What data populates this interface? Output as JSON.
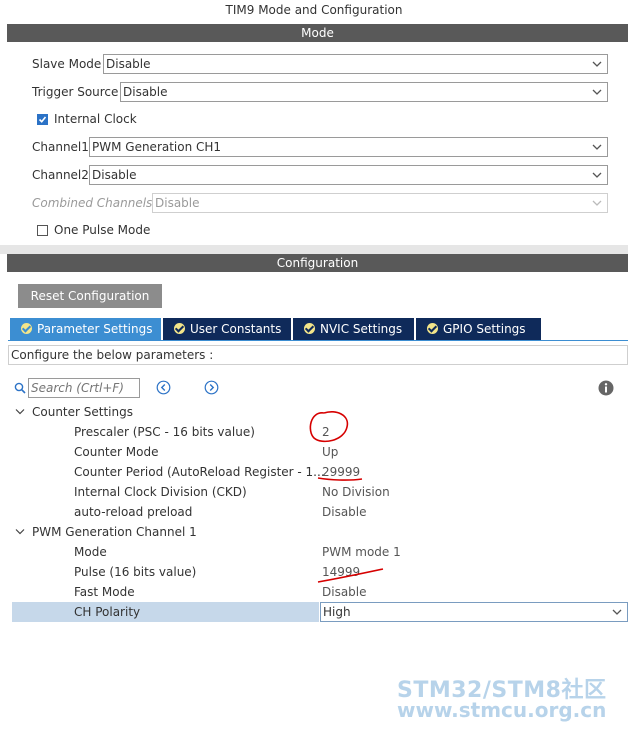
{
  "window": {
    "title": "TIM9 Mode and Configuration"
  },
  "mode": {
    "header": "Mode",
    "slave_mode": {
      "label": "Slave Mode",
      "value": "Disable"
    },
    "trigger_source": {
      "label": "Trigger Source",
      "value": "Disable"
    },
    "internal_clock": {
      "label": "Internal Clock",
      "checked": true
    },
    "channel1": {
      "label": "Channel1",
      "value": "PWM Generation CH1"
    },
    "channel2": {
      "label": "Channel2",
      "value": "Disable"
    },
    "combined_channels": {
      "label": "Combined Channels",
      "value": "Disable"
    },
    "one_pulse_mode": {
      "label": "One Pulse Mode",
      "checked": false
    }
  },
  "configuration": {
    "header": "Configuration",
    "reset_button": "Reset Configuration",
    "tabs": [
      {
        "label": "Parameter Settings",
        "active": true
      },
      {
        "label": "User Constants",
        "active": false
      },
      {
        "label": "NVIC Settings",
        "active": false
      },
      {
        "label": "GPIO Settings",
        "active": false
      }
    ],
    "instruction": "Configure the below parameters :",
    "search": {
      "placeholder": "Search (Crtl+F)"
    },
    "groups": {
      "counter": {
        "title": "Counter Settings",
        "rows": [
          {
            "label": "Prescaler (PSC - 16 bits value)",
            "value": "2"
          },
          {
            "label": "Counter Mode",
            "value": "Up"
          },
          {
            "label": "Counter Period (AutoReload Register - 1...",
            "value": "29999"
          },
          {
            "label": "Internal Clock Division (CKD)",
            "value": "No Division"
          },
          {
            "label": "auto-reload preload",
            "value": "Disable"
          }
        ]
      },
      "pwm": {
        "title": "PWM Generation Channel 1",
        "rows": [
          {
            "label": "Mode",
            "value": "PWM mode 1"
          },
          {
            "label": "Pulse (16 bits value)",
            "value": "14999"
          },
          {
            "label": "Fast Mode",
            "value": "Disable"
          },
          {
            "label": "CH Polarity",
            "value": "High"
          }
        ]
      }
    }
  },
  "watermark": {
    "line1": "STM32/STM8社区",
    "line2": "www.stmcu.org.cn"
  },
  "colors": {
    "accent": "#3c8ed2",
    "tab_dark": "#0f2a5a",
    "annotation": "#d60000",
    "selected_row": "#c6d8ea"
  }
}
